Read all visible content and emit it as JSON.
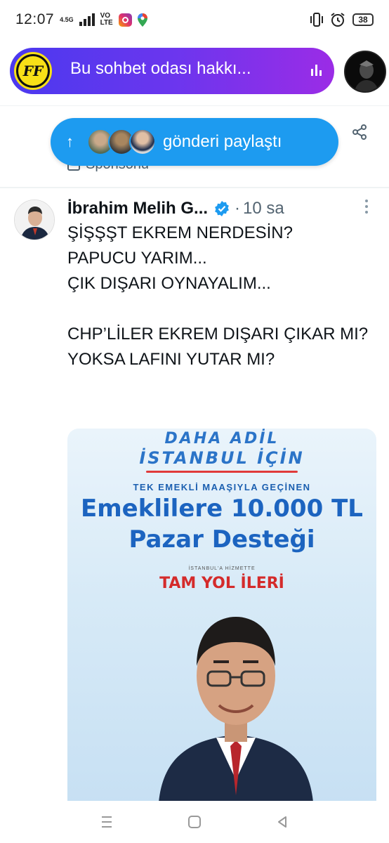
{
  "status_bar": {
    "time": "12:07",
    "network_small": "4.5G",
    "volte_1": "VO",
    "volte_2": "LTE",
    "battery": "38"
  },
  "chat_header": {
    "title": "Bu sohbet odası hakkı...",
    "room_icon_text": "FF"
  },
  "underlay": {
    "sponsored": "Sponsorlu"
  },
  "notification": {
    "text": "gönderi paylaştı"
  },
  "tweet": {
    "author_name": "İbrahim Melih G...",
    "dot": "·",
    "time": "10 sa",
    "text": "ŞİŞŞŞT EKREM NERDESİN?\nPAPUCU YARIM...\nÇIK DIŞARI OYNAYALIM...\n\nCHP’LİLER EKREM DIŞARI ÇIKAR MI?\nYOKSA LAFINI YUTAR MI?"
  },
  "poster": {
    "line1": "DAHA ADİL",
    "line2": "İSTANBUL İÇİN",
    "sub": "TEK EMEKLİ MAAŞIYLA GEÇİNEN",
    "headline1": "Emeklilere 10.000 TL",
    "headline2": "Pazar Desteği",
    "small": "İSTANBUL'A HİZMETTE",
    "slogan": "TAM YOL İLERİ"
  },
  "colors": {
    "accent": "#1d9bf0",
    "chat_gradient_start": "#4b39ef",
    "chat_gradient_end": "#9b2ce6",
    "verified": "#1d9bf0"
  }
}
